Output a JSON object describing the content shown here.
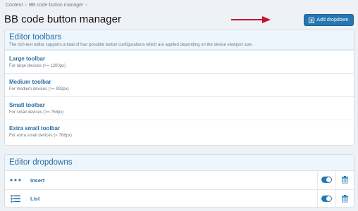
{
  "breadcrumb": {
    "items": [
      "Content",
      "BB code button manager"
    ],
    "separator": "›"
  },
  "page": {
    "title": "BB code button manager"
  },
  "actions": {
    "add_dropdown_label": "Add dropdown",
    "add_dropdown_icon": "plus-square-icon"
  },
  "toolbars_panel": {
    "title": "Editor toolbars",
    "description": "The rich-text editor supports a total of four possible button configurations which are applied depending on the device viewport size.",
    "items": [
      {
        "name": "Large toolbar",
        "hint": "For large devices (>= 1200px)"
      },
      {
        "name": "Medium toolbar",
        "hint": "For medium devices (>= 992px)"
      },
      {
        "name": "Small toolbar",
        "hint": "For small devices (>= 768px)"
      },
      {
        "name": "Extra small toolbar",
        "hint": "For extra small devices (< 768px)"
      }
    ]
  },
  "dropdowns_panel": {
    "title": "Editor dropdowns",
    "items": [
      {
        "name": "Insert",
        "icon": "ellipsis-icon",
        "enabled": true
      },
      {
        "name": "List",
        "icon": "list-icon",
        "enabled": true
      }
    ]
  },
  "colors": {
    "accent": "#2577b1",
    "link": "#2b6ca3",
    "annotation_arrow": "#c8102e",
    "panel_header_bg": "#edf6fd",
    "page_bg": "#eef1f5"
  }
}
